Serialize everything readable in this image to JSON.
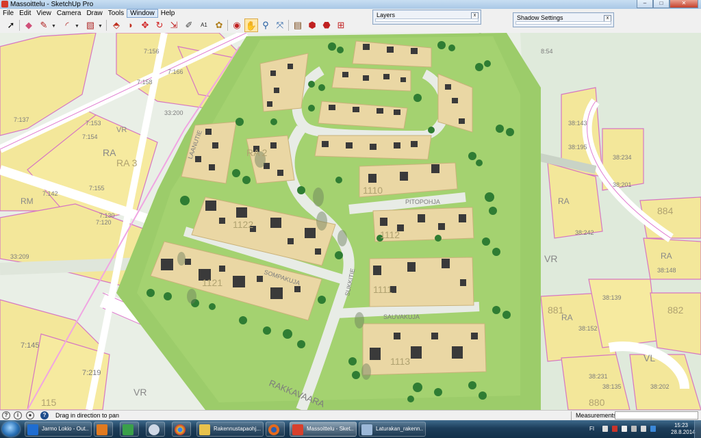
{
  "window": {
    "title": "Massoittelu - SketchUp Pro",
    "close": "✕",
    "minimize": "–",
    "maximize": "□"
  },
  "menu": [
    "File",
    "Edit",
    "View",
    "Camera",
    "Draw",
    "Tools",
    "Window",
    "Help"
  ],
  "menu_highlight_index": 6,
  "toolbar": {
    "tools": [
      "select-arrow-icon",
      "eraser-icon",
      "pencil-line-icon",
      "arc-icon",
      "rectangle-icon",
      "push-pull-icon",
      "follow-me-icon",
      "move-icon",
      "rotate-icon",
      "scale-icon",
      "tape-measure-icon",
      "text-icon",
      "paint-bucket-icon",
      "orbit-icon",
      "pan-hand-icon",
      "zoom-icon",
      "zoom-extents-icon",
      "components-icon",
      "warehouse-icon",
      "share-model-icon",
      "extension-icon"
    ],
    "active_tool": "pan-hand-icon",
    "text_tool_label": "A1"
  },
  "trays": {
    "layers": {
      "title": "Layers",
      "close": "x"
    },
    "shadow": {
      "title": "Shadow Settings",
      "close": "x"
    }
  },
  "map": {
    "street_labels": [
      "RAKKAVAARA",
      "SUKKITIE",
      "SOMPAKUJA",
      "SAUVAKUJA",
      "PITOPOHJA",
      "LAANUTIE"
    ],
    "zone_labels": [
      "VR",
      "VR",
      "VR",
      "RA",
      "RA",
      "RA",
      "RA",
      "VL",
      "RM"
    ],
    "block_numbers": [
      "7:158",
      "7:137",
      "7:156",
      "7:155",
      "7:153",
      "7:130",
      "7:142",
      "7:120",
      "7:219",
      "7:154",
      "7:166",
      "7:145",
      "33:200",
      "33:209",
      "38:242",
      "38:152",
      "38:143",
      "38:234",
      "38:231",
      "38:202",
      "38:201",
      "38:148",
      "38:195",
      "38:139",
      "38:135",
      "8:54"
    ],
    "lot_numbers": [
      "1110",
      "1111",
      "1122",
      "1121",
      "1112",
      "1113",
      "881",
      "882",
      "884",
      "880",
      "RA 3",
      "RA 2",
      "115"
    ]
  },
  "status": {
    "hint": "Drag in direction to pan",
    "measurements_label": "Measurements",
    "measurements_value": ""
  },
  "taskbar": {
    "items": [
      {
        "label": "Jarmo Lokio - Out...",
        "icon": "outlook-icon",
        "color": "#1f6dd1"
      },
      {
        "label": "",
        "icon": "media-icon",
        "color": "#e07a20"
      },
      {
        "label": "",
        "icon": "chart-app-icon",
        "color": "#3aa04a"
      },
      {
        "label": "",
        "icon": "wifi-app-icon",
        "color": "#cfd8e6"
      },
      {
        "label": "",
        "icon": "chrome-icon",
        "color": "#e0c030"
      },
      {
        "label": "Rakennustapaohj...",
        "icon": "folder-icon",
        "color": "#e8c24c"
      },
      {
        "label": "",
        "icon": "firefox-icon",
        "color": "#e46a1e"
      },
      {
        "label": "Massoittelu - Sket...",
        "icon": "sketchup-icon",
        "color": "#d8402c"
      },
      {
        "label": "Laturakan_rakenn...",
        "icon": "document-icon",
        "color": "#9bb8d8"
      }
    ],
    "active_index": 7,
    "lang": "FI",
    "time": "15:23",
    "date": "28.8.2014"
  }
}
